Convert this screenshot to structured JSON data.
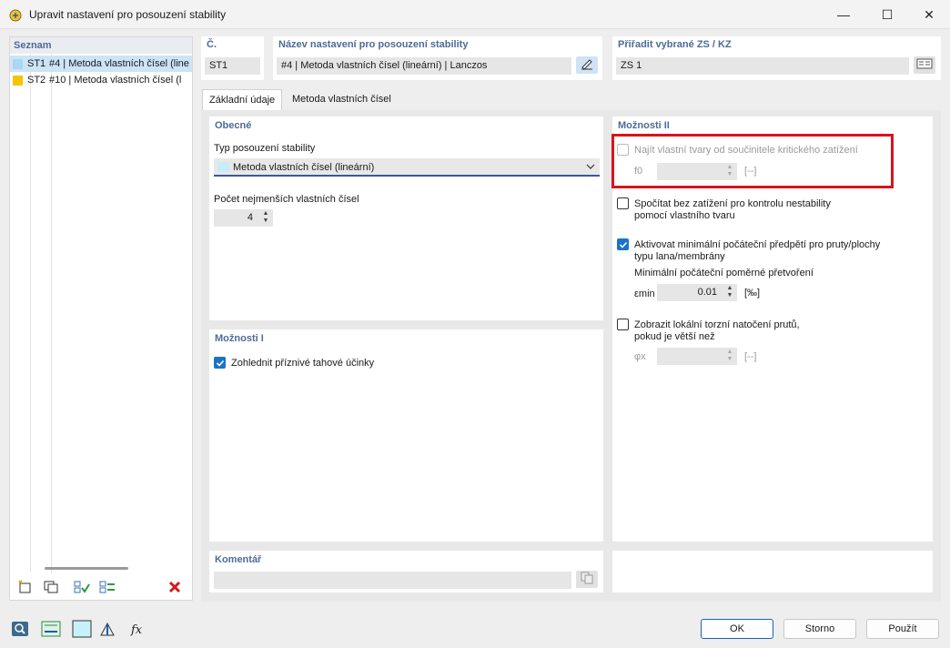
{
  "window": {
    "title": "Upravit nastavení pro posouzení stability",
    "minimize": "—",
    "maximize": "☐",
    "close": "✕"
  },
  "list": {
    "header": "Seznam",
    "items": [
      {
        "id": "ST1",
        "label": "#4 | Metoda vlastních čísel (line",
        "color": "#a9d8f0"
      },
      {
        "id": "ST2",
        "label": "#10 | Metoda vlastních čísel (l",
        "color": "#f5c400"
      }
    ]
  },
  "header": {
    "number_label": "Č.",
    "number_value": "ST1",
    "name_label": "Název nastavení pro posouzení stability",
    "name_value": "#4 | Metoda vlastních čísel (lineární) | Lanczos",
    "assign_label": "Přiřadit vybrané ZS / KZ",
    "assign_value": "ZS 1"
  },
  "tabs": [
    "Základní údaje",
    "Metoda vlastních čísel"
  ],
  "general": {
    "title": "Obecné",
    "type_label": "Typ posouzení stability",
    "type_value": "Metoda vlastních čísel (lineární)",
    "count_label": "Počet nejmenších vlastních čísel",
    "count_value": "4"
  },
  "options1": {
    "title": "Možnosti I",
    "tension_label": "Zohlednit příznivé tahové účinky"
  },
  "options2": {
    "title": "Možnosti II",
    "find_modes_label": "Najít vlastní tvary od součinitele kritického zatížení",
    "f0_symbol": "f0",
    "f0_unit": "[--]",
    "unloaded_label_1": "Spočítat bez zatížení pro kontrolu nestability",
    "unloaded_label_2": "pomocí vlastního tvaru",
    "prestress_label_1": "Aktivovat minimální počáteční předpětí pro pruty/plochy",
    "prestress_label_2": "typu lana/membrány",
    "min_strain_label": "Minimální počáteční poměrné přetvoření",
    "eps_symbol": "εmin",
    "eps_value": "0.01",
    "eps_unit": "[‰]",
    "torsion_label_1": "Zobrazit lokální torzní natočení prutů,",
    "torsion_label_2": "pokud je větší než",
    "phi_symbol": "φx",
    "phi_unit": "[--]"
  },
  "comment": {
    "title": "Komentář"
  },
  "buttons": {
    "ok": "OK",
    "cancel": "Storno",
    "apply": "Použít"
  },
  "colors": {
    "accent": "#1a73c8",
    "section_title": "#4e6b96",
    "highlight_box": "#d9141c"
  }
}
